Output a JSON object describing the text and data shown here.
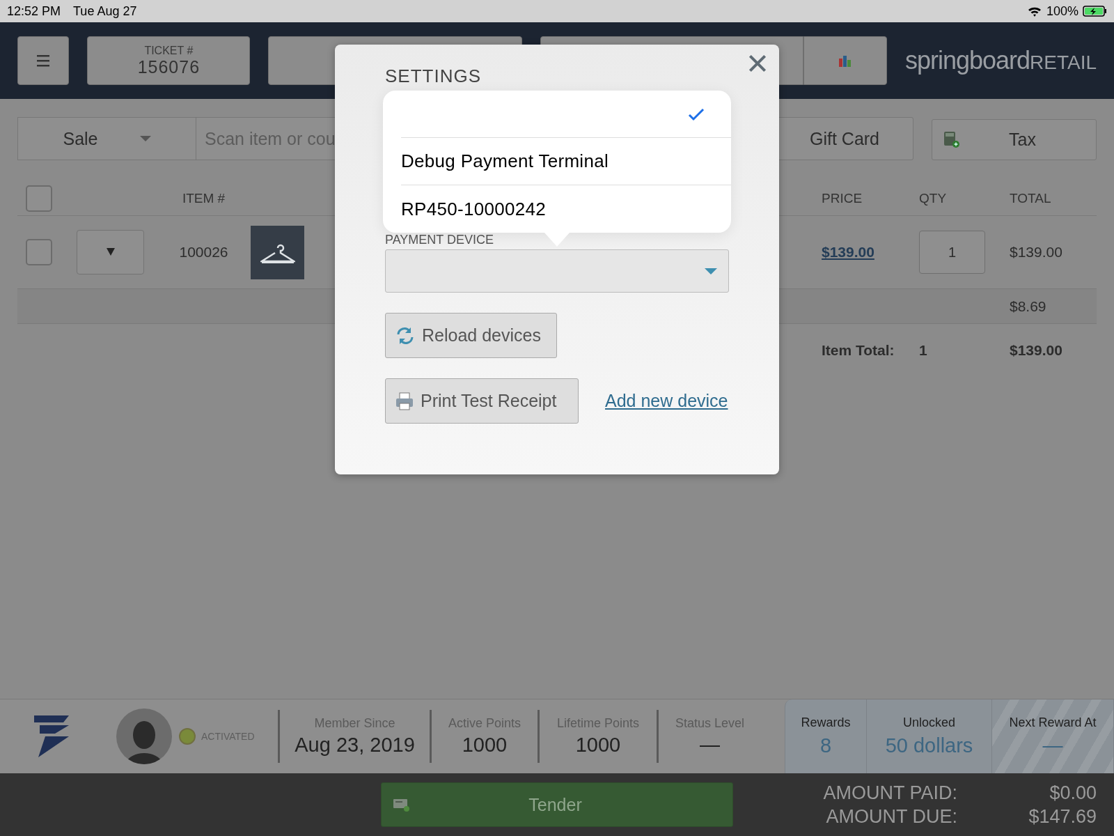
{
  "status_bar": {
    "time": "12:52 PM",
    "date": "Tue Aug 27",
    "battery": "100%"
  },
  "header": {
    "ticket_label": "TICKET #",
    "ticket_number": "156076",
    "logo_main": "springboard",
    "logo_sub": "RETAIL"
  },
  "toolbar": {
    "mode": "Sale",
    "search": {
      "placeholder": "Scan item or cou"
    },
    "gift_card": "Gift Card",
    "tax": "Tax"
  },
  "table": {
    "select_all_checked": false,
    "columns": [
      "ITEM #",
      "PRICE",
      "QTY",
      "TOTAL"
    ],
    "rows": [
      {
        "item": "100026",
        "price": "$139.00",
        "qty": "1",
        "total": "$139.00",
        "checked": false
      }
    ],
    "tax": "$8.69",
    "total_label": "Item Total:",
    "total_qty": "1",
    "total_amount": "$139.00"
  },
  "modal": {
    "title": "SETTINGS",
    "field_label": "PAYMENT DEVICE",
    "options": [
      {
        "selected": true
      },
      {
        "label": "Debug Payment Terminal",
        "selected": false
      },
      {
        "label": "RP450-10000242",
        "selected": false
      }
    ],
    "reload_button": "Reload devices",
    "print_button": "Print Test Receipt",
    "add_link": "Add new device"
  },
  "loyalty": {
    "status": "ACTIVATED",
    "stats": [
      {
        "label": "Member Since",
        "value": "Aug 23, 2019"
      },
      {
        "label": "Active Points",
        "value": "1000"
      },
      {
        "label": "Lifetime Points",
        "value": "1000"
      },
      {
        "label": "Status Level",
        "value": "—"
      }
    ],
    "rewards": [
      {
        "label": "Rewards",
        "value": "8"
      },
      {
        "label": "Unlocked",
        "value": "50 dollars"
      },
      {
        "label": "Next Reward At",
        "value": "—"
      }
    ]
  },
  "footer": {
    "tender": "Tender",
    "paid_label": "AMOUNT PAID:",
    "paid_value": "$0.00",
    "due_label": "AMOUNT DUE:",
    "due_value": "$147.69"
  }
}
